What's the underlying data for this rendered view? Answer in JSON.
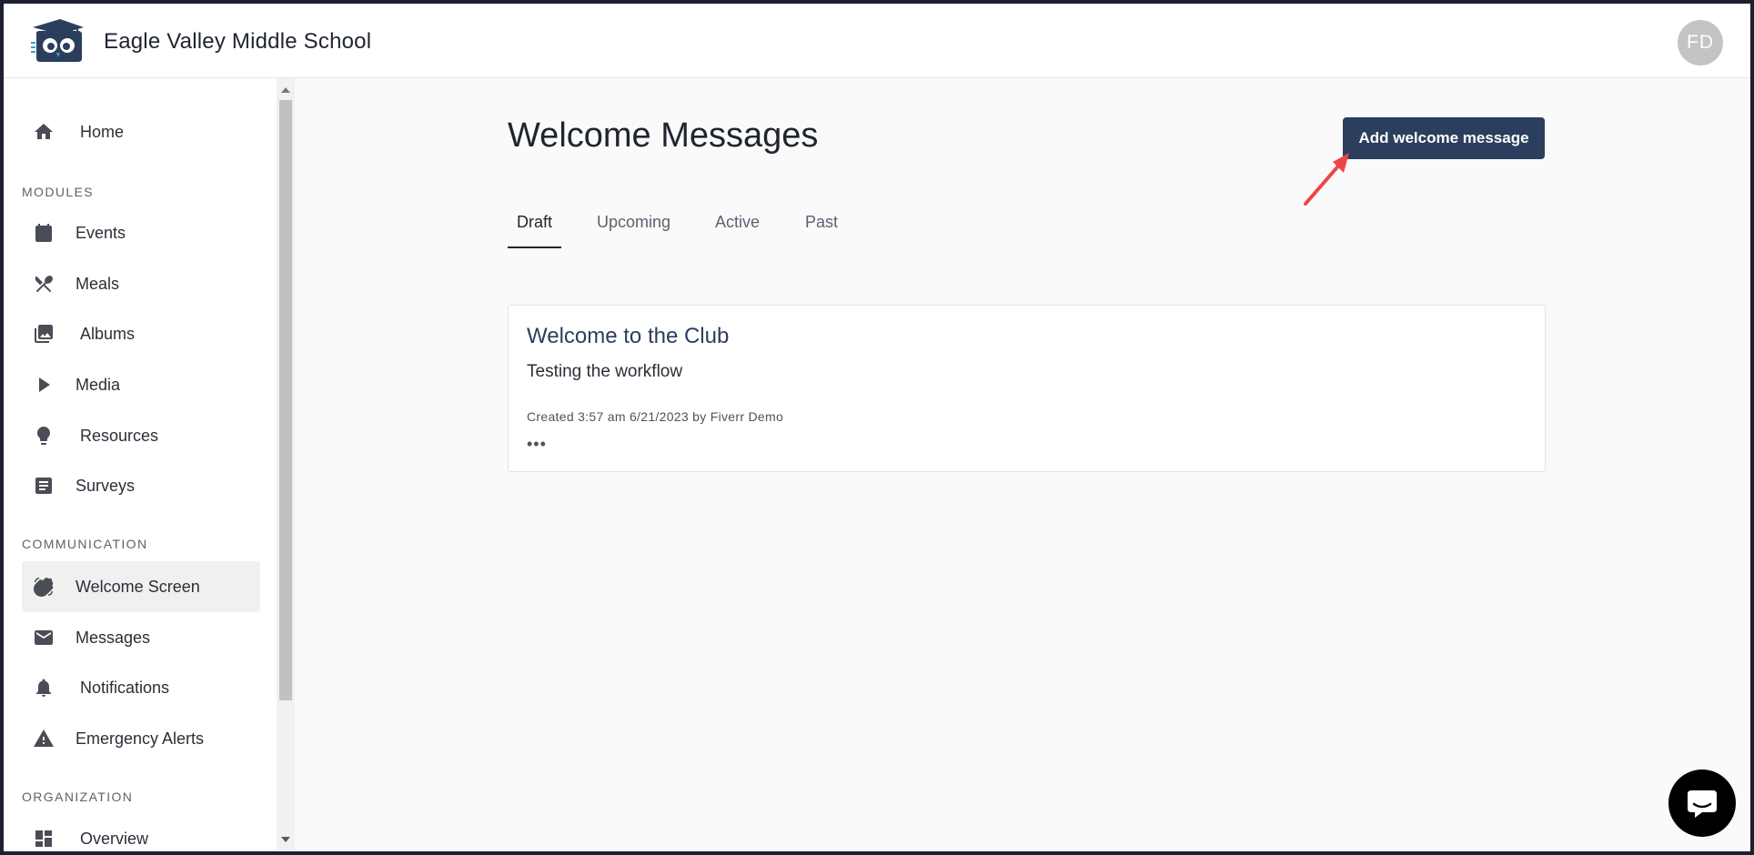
{
  "header": {
    "school_name": "Eagle Valley Middle School",
    "avatar_initials": "FD"
  },
  "sidebar": {
    "home": "Home",
    "sections": {
      "modules": "MODULES",
      "communication": "COMMUNICATION",
      "organization": "ORGANIZATION"
    },
    "modules": [
      "Events",
      "Meals",
      "Albums",
      "Media",
      "Resources",
      "Surveys"
    ],
    "communication": [
      "Welcome Screen",
      "Messages",
      "Notifications",
      "Emergency Alerts"
    ],
    "organization": [
      "Overview"
    ],
    "active_item": "Welcome Screen"
  },
  "main": {
    "title": "Welcome Messages",
    "add_button": "Add welcome message",
    "tabs": [
      "Draft",
      "Upcoming",
      "Active",
      "Past"
    ],
    "active_tab": "Draft",
    "card": {
      "title": "Welcome to the Club",
      "body": "Testing the workflow",
      "meta": "Created 3:57 am 6/21/2023 by Fiverr Demo",
      "more": "•••"
    }
  },
  "colors": {
    "primary": "#2c3e5e",
    "annotation_arrow": "#f04545"
  }
}
